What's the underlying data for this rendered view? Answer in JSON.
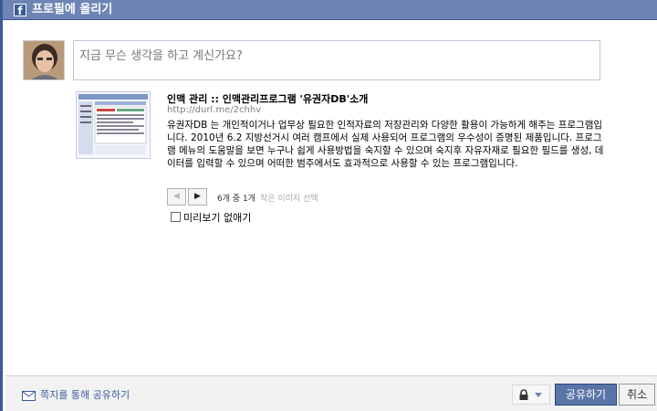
{
  "dialog": {
    "title": "프로필에 올리기",
    "logo_letter": "f"
  },
  "composer": {
    "placeholder": "지금 무슨 생각을 하고 계신가요?"
  },
  "link": {
    "title": "인맥 관리 :: 인맥관리프로그램 '유권자DB'소개",
    "url": "http://durl.me/2chhv",
    "description": "유권자DB 는 개인적이거나 업무상 필요한 인적자료의 저장관리와 다양한 활용이 가능하게 해주는 프로그램입니다.   2010년 6.2 지방선거시  여러 캠프에서  실제 사용되어 프로그램의 우수성이 증명된 제품입니다.   프로그램 메뉴의 도움말을 보면 누구나 쉽게 사용방법을 숙지할 수 있으며 숙지후 자유자재로 필요한 필드를 생성, 데이터를 입력할 수 있으며 어떠한 범주에서도 효과적으로 사용할 수 있는 프로그램입니다."
  },
  "pager": {
    "prev_glyph": "◀",
    "next_glyph": "▶",
    "count": "6개 중 1개",
    "no_thumbnail": "작은 이미지 선택"
  },
  "options": {
    "no_preview_label": "미리보기 없애기",
    "no_preview_checked": false
  },
  "footer": {
    "message_link": "쪽지를 통해 공유하기",
    "share_label": "공유하기",
    "cancel_label": "취소"
  },
  "colors": {
    "brand": "#3b5998",
    "titlebar": "#6d84b4"
  }
}
